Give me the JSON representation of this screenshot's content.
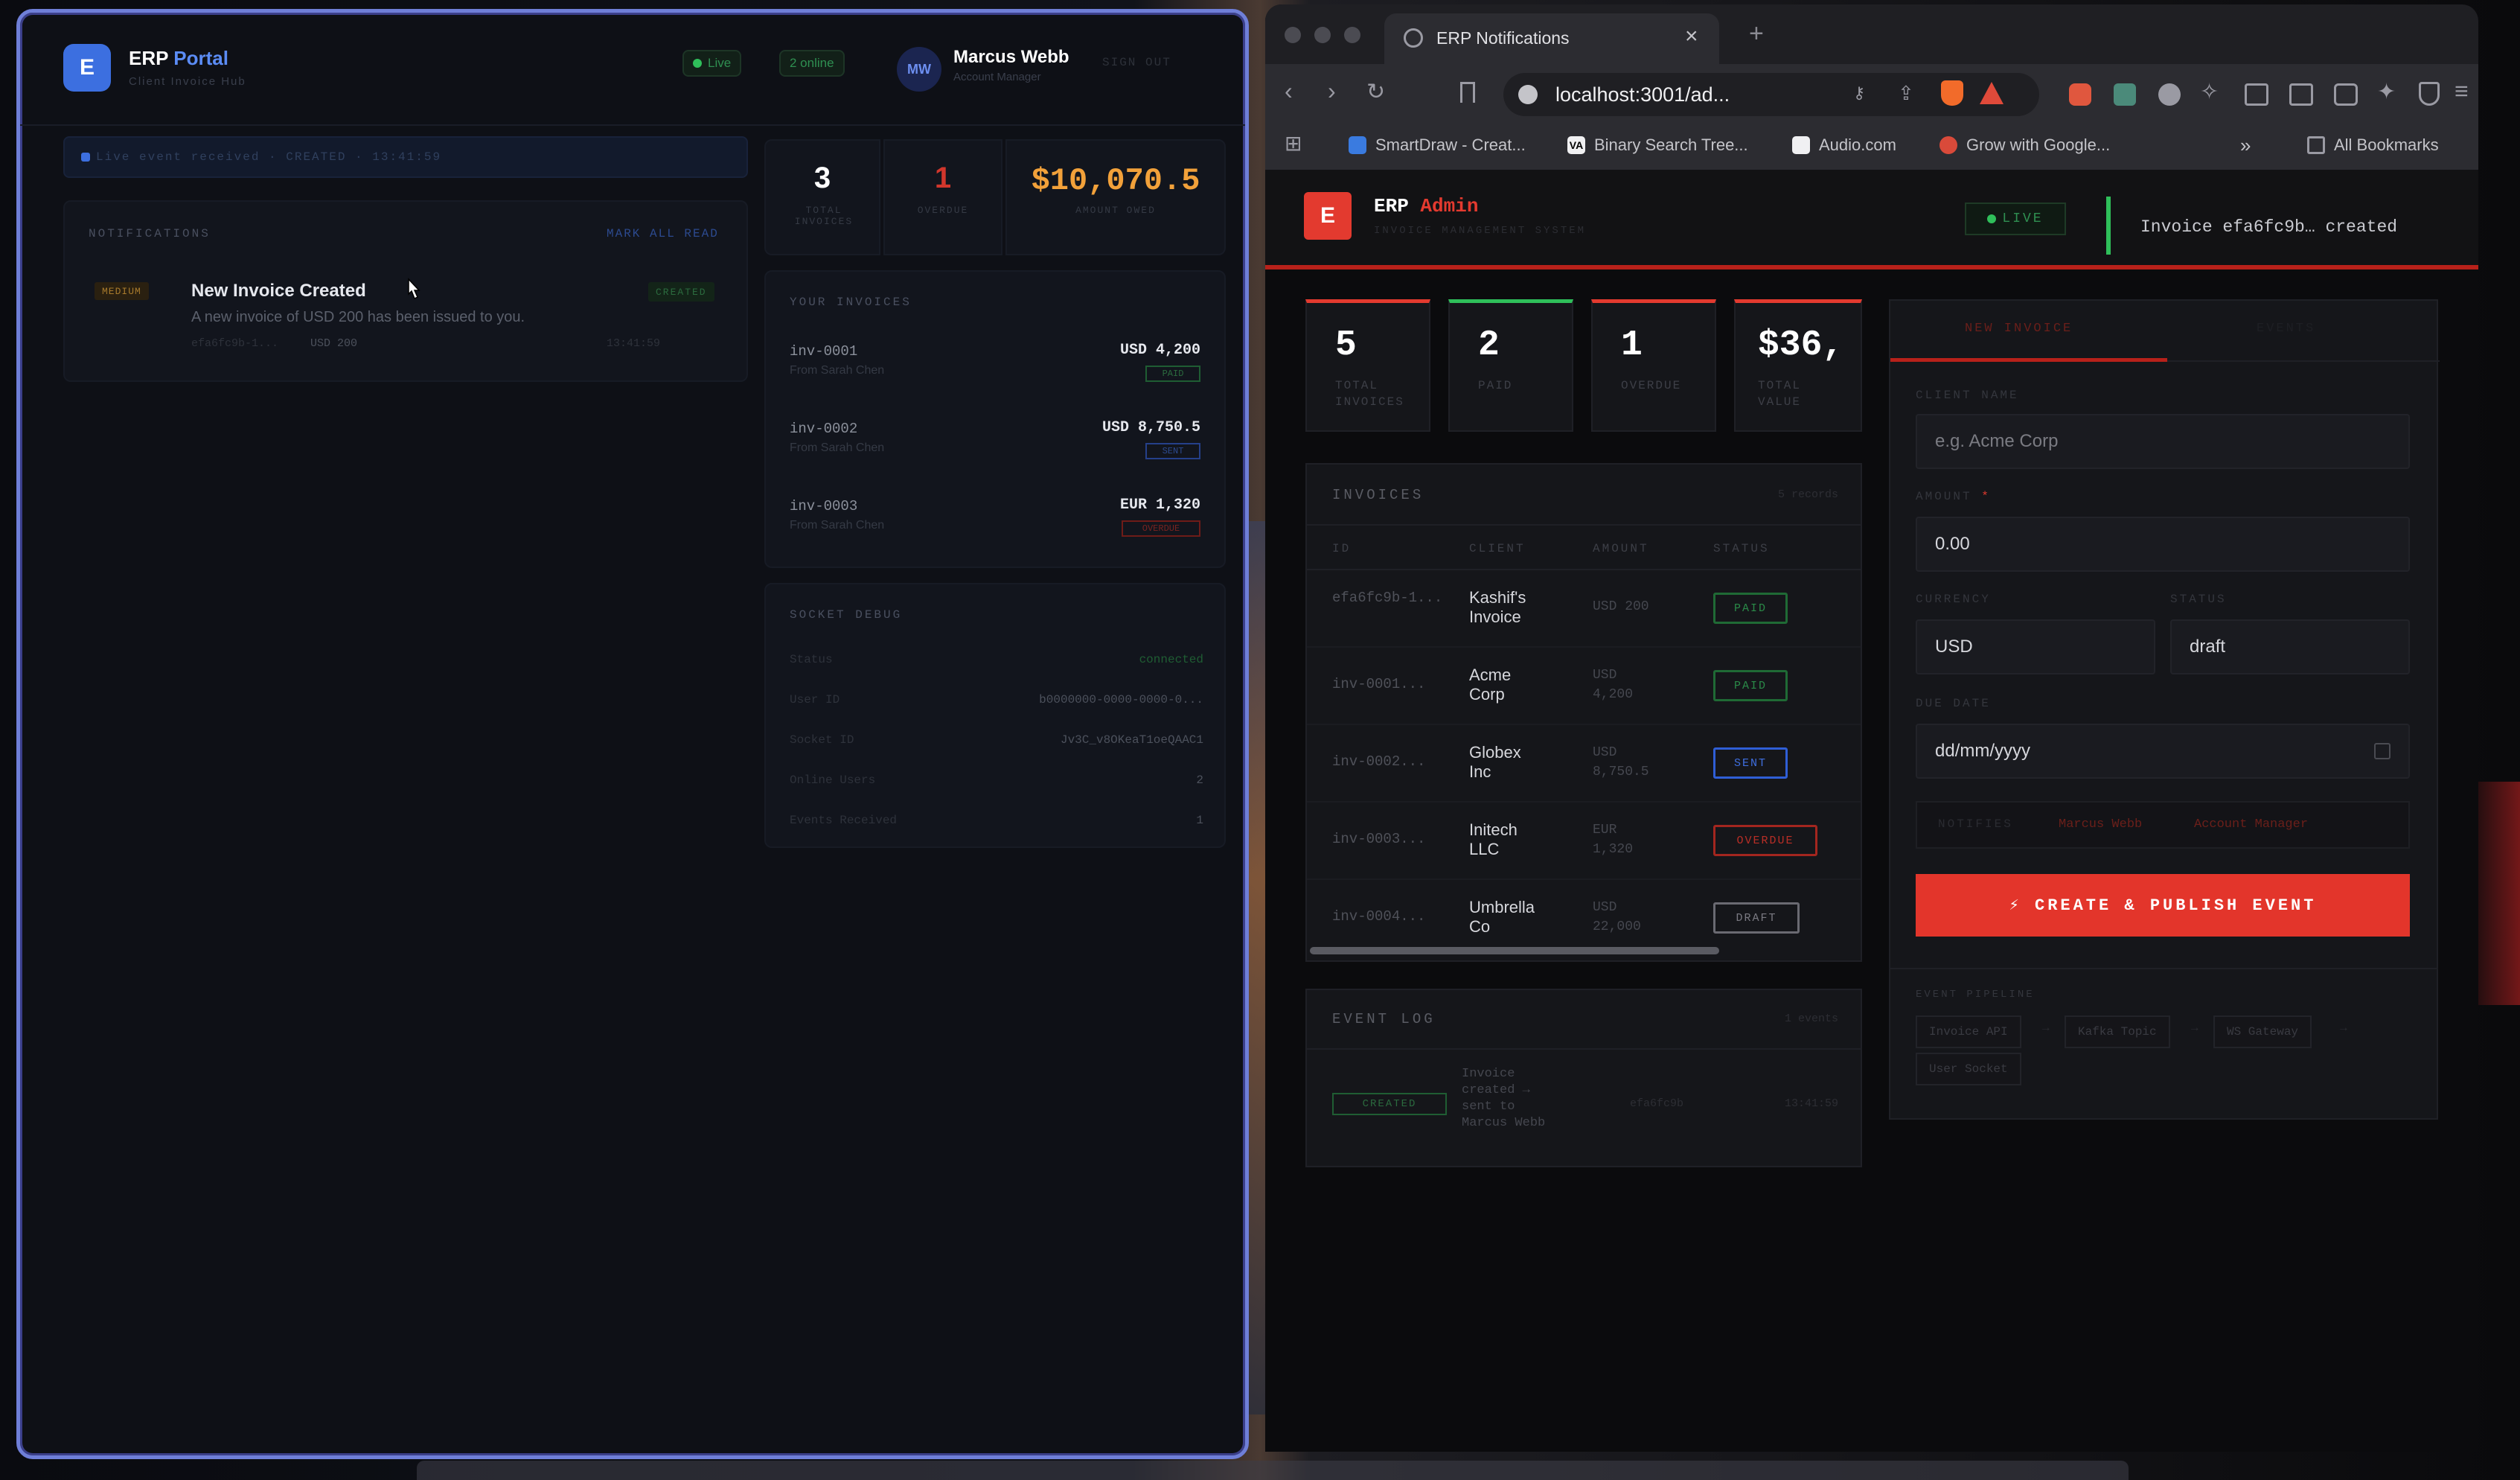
{
  "portal": {
    "brand": "ERP",
    "brand_accent": "Portal",
    "subtitle": "Client Invoice Hub",
    "status_live": "Live",
    "status_online": "2 online",
    "avatar_initials": "MW",
    "user_name": "Marcus Webb",
    "user_role": "Account Manager",
    "sign_out": "SIGN OUT",
    "event_banner": "Live event received · CREATED · 13:41:59",
    "notifications_title": "NOTIFICATIONS",
    "mark_all_read": "MARK ALL READ",
    "notification": {
      "priority": "MEDIUM",
      "title": "New Invoice Created",
      "body": "A new invoice of USD 200 has been issued to you.",
      "meta_id": "efa6fc9b-1...",
      "meta_amount": "USD 200",
      "time": "13:41:59",
      "badge": "CREATED"
    },
    "stats": [
      {
        "value": "3",
        "label": "TOTAL INVOICES"
      },
      {
        "value": "1",
        "label": "OVERDUE"
      },
      {
        "value": "$10,070.5",
        "label": "AMOUNT OWED"
      }
    ],
    "your_invoices_title": "YOUR INVOICES",
    "invoices": [
      {
        "id": "inv-0001",
        "from": "From Sarah Chen",
        "amount": "USD 4,200",
        "status": "PAID"
      },
      {
        "id": "inv-0002",
        "from": "From Sarah Chen",
        "amount": "USD 8,750.5",
        "status": "SENT"
      },
      {
        "id": "inv-0003",
        "from": "From Sarah Chen",
        "amount": "EUR 1,320",
        "status": "OVERDUE"
      }
    ],
    "socket_title": "SOCKET DEBUG",
    "socket": [
      {
        "k": "Status",
        "v": "connected"
      },
      {
        "k": "User ID",
        "v": "b0000000-0000-0000-0..."
      },
      {
        "k": "Socket ID",
        "v": "Jv3C_v8OKeaT1oeQAAC1"
      },
      {
        "k": "Online Users",
        "v": "2"
      },
      {
        "k": "Events Received",
        "v": "1"
      }
    ]
  },
  "browser": {
    "tab_title": "ERP Notifications",
    "new_tab": "+",
    "url": "localhost:3001/ad...",
    "bookmarks": [
      "SmartDraw - Creat...",
      "Binary Search Tree...",
      "Audio.com",
      "Grow with Google..."
    ],
    "more": "»",
    "all_bookmarks": "All Bookmarks"
  },
  "admin": {
    "brand": "ERP",
    "brand_accent": "Admin",
    "subtitle": "INVOICE MANAGEMENT SYSTEM",
    "live": "LIVE",
    "toast": "Invoice efa6fc9b… created",
    "stats": [
      {
        "value": "5",
        "label": "TOTAL INVOICES",
        "accent": "#e33a2f"
      },
      {
        "value": "2",
        "label": "PAID",
        "accent": "#2fbf5a"
      },
      {
        "value": "1",
        "label": "OVERDUE",
        "accent": "#e33a2f"
      },
      {
        "value": "$36,",
        "label": "TOTAL VALUE",
        "accent": "#e33a2f"
      }
    ],
    "invoices_title": "INVOICES",
    "records": "5 records",
    "columns": [
      "ID",
      "CLIENT",
      "AMOUNT",
      "STATUS"
    ],
    "rows": [
      {
        "id": "efa6fc9b-1...",
        "client": "Kashif's Invoice",
        "amount": "USD 200",
        "status": "PAID"
      },
      {
        "id": "inv-0001...",
        "client": "Acme Corp",
        "amount": "USD 4,200",
        "status": "PAID"
      },
      {
        "id": "inv-0002...",
        "client": "Globex Inc",
        "amount": "USD 8,750.5",
        "status": "SENT"
      },
      {
        "id": "inv-0003...",
        "client": "Initech LLC",
        "amount": "EUR 1,320",
        "status": "OVERDUE"
      },
      {
        "id": "inv-0004...",
        "client": "Umbrella Co",
        "amount": "USD 22,000",
        "status": "DRAFT"
      }
    ],
    "event_log_title": "EVENT LOG",
    "event_count": "1 events",
    "event": {
      "badge": "CREATED",
      "text": "Invoice created → sent to Marcus Webb",
      "id": "efa6fc9b",
      "time": "13:41:59"
    },
    "form": {
      "tab_new": "NEW INVOICE",
      "tab_other": "EVENTS",
      "client_label": "CLIENT NAME",
      "client_placeholder": "e.g. Acme Corp",
      "amount_label": "AMOUNT",
      "required": "*",
      "amount_value": "0.00",
      "currency_label": "CURRENCY",
      "currency_value": "USD",
      "status_label": "STATUS",
      "status_value": "draft",
      "due_label": "DUE DATE",
      "due_placeholder": "dd/mm/yyyy",
      "notify_label": "NOTIFIES",
      "notify_name": "Marcus Webb",
      "notify_role": "Account Manager",
      "submit": "⚡ CREATE & PUBLISH EVENT",
      "pipeline_title": "EVENT PIPELINE",
      "pipeline": [
        "Invoice API",
        "Kafka Topic",
        "WS Gateway",
        "User Socket"
      ],
      "arrow": "→"
    }
  },
  "colors": {
    "portal_accent": "#5b8cf5",
    "admin_accent": "#e33a2f",
    "paid": "#2fbf5a",
    "sent": "#3f6fe0",
    "overdue": "#c8302a",
    "draft": "#8a8a92",
    "owed": "#f2a13a"
  }
}
